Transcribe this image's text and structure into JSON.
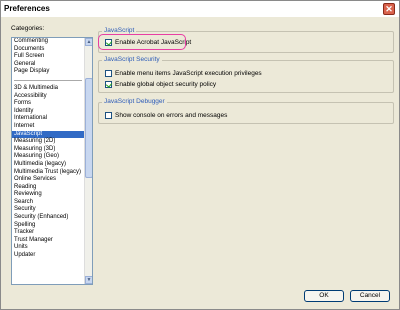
{
  "window": {
    "title": "Preferences"
  },
  "categories": {
    "label": "Categories:",
    "group1": [
      "Commenting",
      "Documents",
      "Full Screen",
      "General",
      "Page Display"
    ],
    "group2": [
      "3D & Multimedia",
      "Accessibility",
      "Forms",
      "Identity",
      "International",
      "Internet",
      "JavaScript",
      "Measuring (2D)",
      "Measuring (3D)",
      "Measuring (Geo)",
      "Multimedia (legacy)",
      "Multimedia Trust (legacy)",
      "Online Services",
      "Reading",
      "Reviewing",
      "Search",
      "Security",
      "Security (Enhanced)",
      "Spelling",
      "Tracker",
      "Trust Manager",
      "Units",
      "Updater"
    ],
    "selected": "JavaScript"
  },
  "javascript": {
    "title": "JavaScript",
    "enable_label": "Enable Acrobat JavaScript",
    "enable_checked": true
  },
  "security": {
    "title": "JavaScript Security",
    "menu_privileges_label": "Enable menu items JavaScript execution privileges",
    "menu_privileges_checked": false,
    "global_policy_label": "Enable global object security policy",
    "global_policy_checked": true
  },
  "debugger": {
    "title": "JavaScript Debugger",
    "show_console_label": "Show console on errors and messages",
    "show_console_checked": false
  },
  "buttons": {
    "ok": "OK",
    "cancel": "Cancel"
  }
}
